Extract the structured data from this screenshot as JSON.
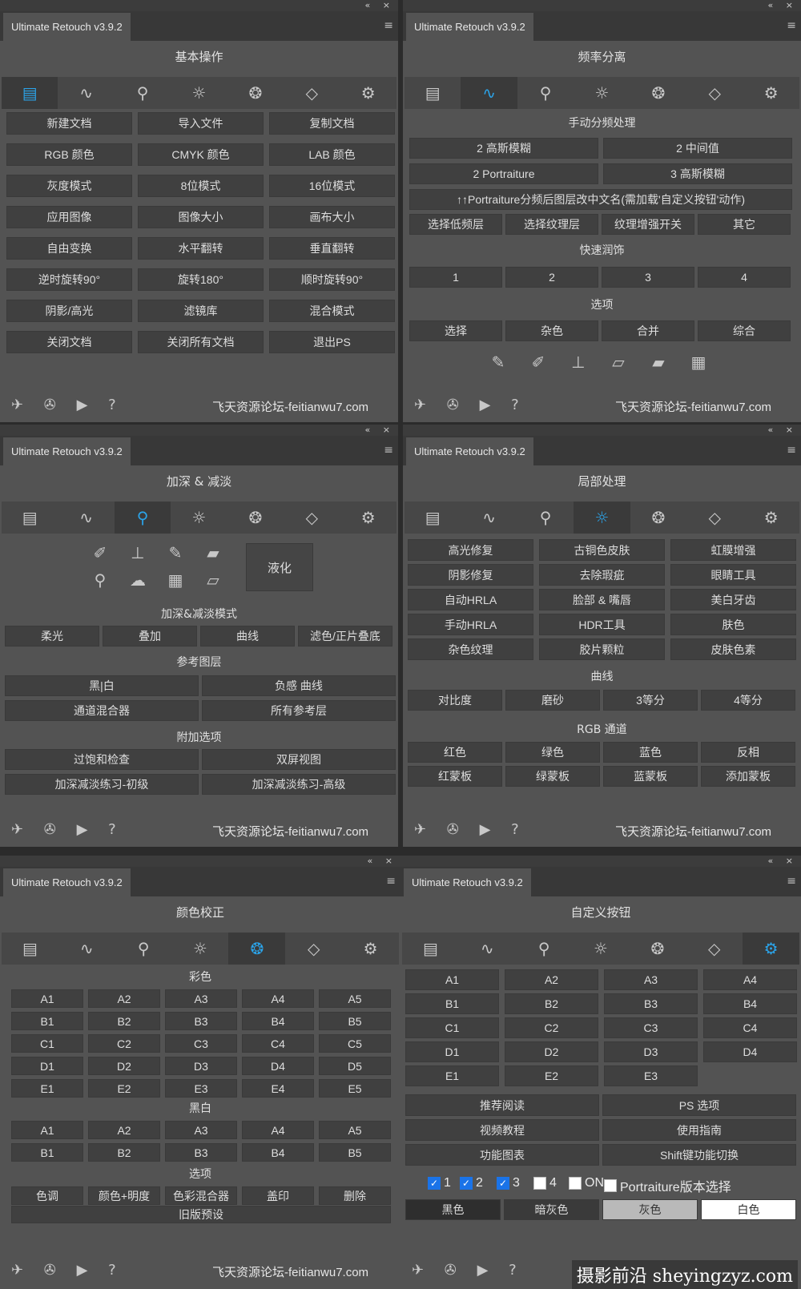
{
  "app": {
    "title": "Ultimate Retouch v3.9.2",
    "window_controls": "« ×",
    "menu_glyph": "≡"
  },
  "footer": {
    "site": "飞天资源论坛-feitianwu7.com"
  },
  "watermark": "摄影前沿 sheyingzyz.com",
  "panel1": {
    "title": "基本操作",
    "buttons": [
      "新建文档",
      "导入文件",
      "复制文档",
      "RGB 颜色",
      "CMYK 颜色",
      "LAB 颜色",
      "灰度模式",
      "8位模式",
      "16位模式",
      "应用图像",
      "图像大小",
      "画布大小",
      "自由变换",
      "水平翻转",
      "垂直翻转",
      "逆时旋转90°",
      "旋转180°",
      "顺时旋转90°",
      "阴影/高光",
      "滤镜库",
      "混合模式",
      "关闭文档",
      "关闭所有文档",
      "退出PS"
    ]
  },
  "panel2": {
    "title": "频率分离",
    "sec_manual": "手动分频处理",
    "row1": [
      "2 高斯模糊",
      "2 中间值"
    ],
    "row2": [
      "2 Portraiture",
      "3 高斯模糊"
    ],
    "wide": "↑↑Portraiture分频后图层改中文名(需加载'自定义按钮'动作)",
    "row3": [
      "选择低频层",
      "选择纹理层",
      "纹理增强开关",
      "其它"
    ],
    "sec_quick": "快速润饰",
    "row4": [
      "1",
      "2",
      "3",
      "4"
    ],
    "sec_opts": "选项",
    "row5": [
      "选择",
      "杂色",
      "合并",
      "综合"
    ]
  },
  "panel3": {
    "title": "加深 & 减淡",
    "liquify": "液化",
    "sec_mode": "加深&减淡模式",
    "row1": [
      "柔光",
      "叠加",
      "曲线",
      "滤色/正片叠底"
    ],
    "sec_ref": "参考图层",
    "row2": [
      "黑|白",
      "负感 曲线"
    ],
    "row3": [
      "通道混合器",
      "所有参考层"
    ],
    "sec_add": "附加选项",
    "row4": [
      "过饱和检查",
      "双屏视图"
    ],
    "row5": [
      "加深减淡练习-初级",
      "加深减淡练习-高级"
    ]
  },
  "panel4": {
    "title": "局部处理",
    "grid": [
      "高光修复",
      "古铜色皮肤",
      "虹膜增强",
      "阴影修复",
      "去除瑕疵",
      "眼睛工具",
      "自动HRLA",
      "脸部 & 嘴唇",
      "美白牙齿",
      "手动HRLA",
      "HDR工具",
      "肤色",
      "杂色纹理",
      "胶片颗粒",
      "皮肤色素"
    ],
    "sec_curve": "曲线",
    "curve": [
      "对比度",
      "磨砂",
      "3等分",
      "4等分"
    ],
    "sec_rgb": "RGB 通道",
    "rgb1": [
      "红色",
      "绿色",
      "蓝色",
      "反相"
    ],
    "rgb2": [
      "红蒙板",
      "绿蒙板",
      "蓝蒙板",
      "添加蒙板"
    ]
  },
  "panel5": {
    "title": "颜色校正",
    "sec_color": "彩色",
    "color": [
      "A1",
      "A2",
      "A3",
      "A4",
      "A5",
      "B1",
      "B2",
      "B3",
      "B4",
      "B5",
      "C1",
      "C2",
      "C3",
      "C4",
      "C5",
      "D1",
      "D2",
      "D3",
      "D4",
      "D5",
      "E1",
      "E2",
      "E3",
      "E4",
      "E5"
    ],
    "sec_bw": "黑白",
    "bw": [
      "A1",
      "A2",
      "A3",
      "A4",
      "A5",
      "B1",
      "B2",
      "B3",
      "B4",
      "B5"
    ],
    "sec_opts": "选项",
    "opts": [
      "色调",
      "颜色+明度",
      "色彩混合器",
      "盖印",
      "删除"
    ],
    "legacy": "旧版预设"
  },
  "panel6": {
    "title": "自定义按钮",
    "grid": [
      "A1",
      "A2",
      "A3",
      "A4",
      "B1",
      "B2",
      "B3",
      "B4",
      "C1",
      "C2",
      "C3",
      "C4",
      "D1",
      "D2",
      "D3",
      "D4",
      "E1",
      "E2",
      "E3"
    ],
    "links": [
      "推荐阅读",
      "PS 选项",
      "视频教程",
      "使用指南",
      "功能图表",
      "Shift键功能切换"
    ],
    "checks": [
      {
        "label": "1",
        "on": true
      },
      {
        "label": "2",
        "on": true
      },
      {
        "label": "3",
        "on": true
      },
      {
        "label": "4",
        "on": false
      },
      {
        "label": "ON",
        "on": false
      },
      {
        "label": "Portraiture版本选择",
        "on": false
      }
    ],
    "themes": [
      "黑色",
      "暗灰色",
      "灰色",
      "白色"
    ]
  },
  "colors": {
    "panel": "#535353",
    "button": "#404040",
    "active_icon": "#2ba3e8",
    "check_on": "#1a73e8"
  }
}
